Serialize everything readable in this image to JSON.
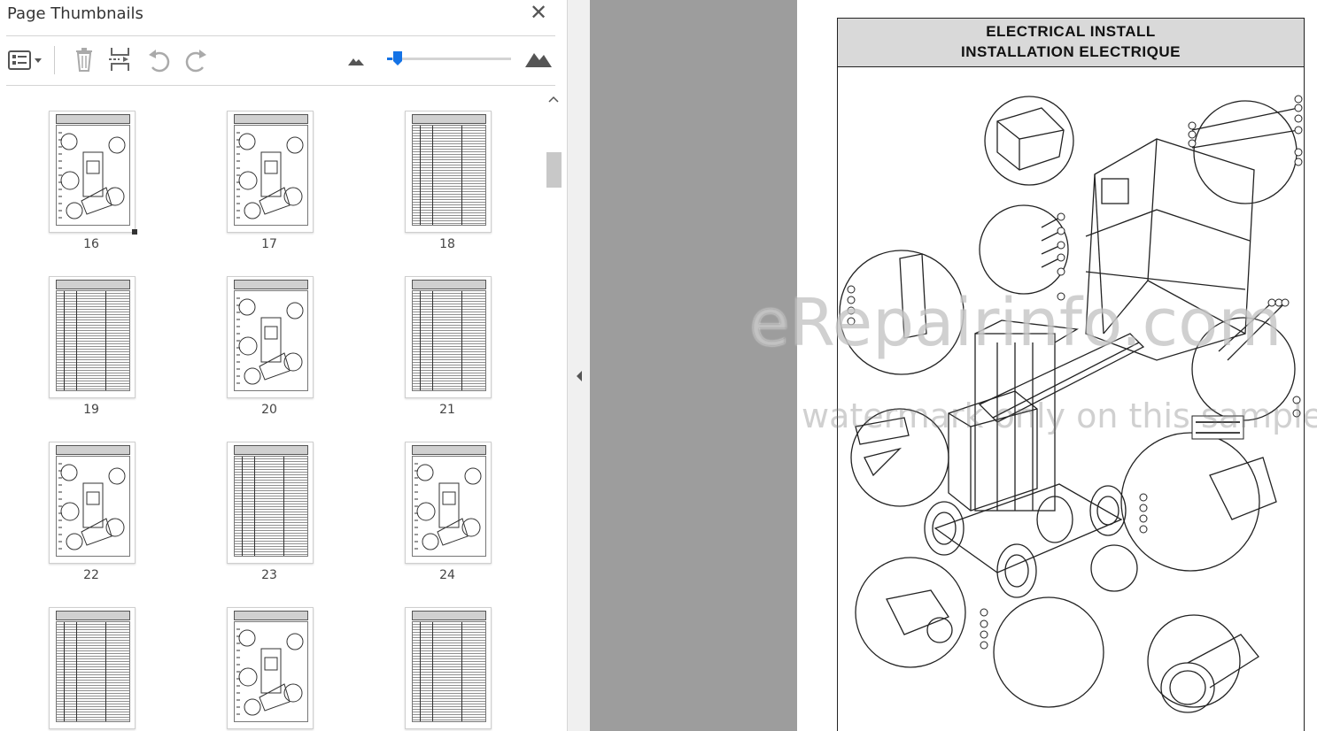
{
  "panel": {
    "title": "Page Thumbnails",
    "close_icon": "close-icon",
    "toolbar": {
      "options_icon": "thumbnail-options-icon",
      "delete_icon": "trash-icon",
      "insert_icon": "insert-pages-icon",
      "rotate_ccw_icon": "rotate-counterclockwise-icon",
      "rotate_cw_icon": "rotate-clockwise-icon",
      "zoom_out_icon": "small-mountain-icon",
      "zoom_in_icon": "large-mountain-icon",
      "zoom_level": 0.04
    },
    "thumbnails": [
      {
        "label": "16",
        "kind": "diagram",
        "selected": true
      },
      {
        "label": "17",
        "kind": "diagram",
        "selected": false
      },
      {
        "label": "18",
        "kind": "table",
        "selected": false
      },
      {
        "label": "19",
        "kind": "table",
        "selected": false
      },
      {
        "label": "20",
        "kind": "diagram",
        "selected": false
      },
      {
        "label": "21",
        "kind": "table",
        "selected": false
      },
      {
        "label": "22",
        "kind": "diagram",
        "selected": false
      },
      {
        "label": "23",
        "kind": "table",
        "selected": false
      },
      {
        "label": "24",
        "kind": "diagram",
        "selected": false
      },
      {
        "label": "",
        "kind": "table",
        "selected": false
      },
      {
        "label": "",
        "kind": "diagram",
        "selected": false
      },
      {
        "label": "",
        "kind": "table",
        "selected": false
      }
    ]
  },
  "document": {
    "title_line1": "ELECTRICAL INSTALL",
    "title_line2": "INSTALLATION ELECTRIQUE",
    "watermark_line1": "eRepairinfo.com",
    "watermark_line2": "watermark only on this sample"
  },
  "colors": {
    "accent": "#1473e6",
    "gray_area": "#9d9d9d",
    "header_fill": "#d9d9d9"
  }
}
